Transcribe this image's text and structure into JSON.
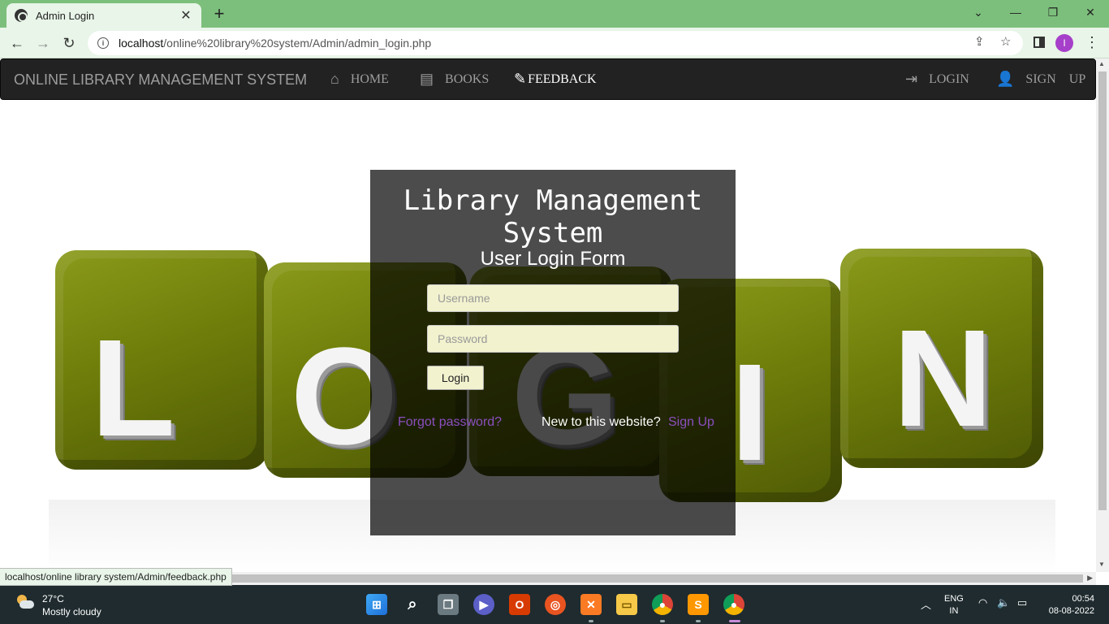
{
  "browser": {
    "tab_title": "Admin Login",
    "tab_close": "✕",
    "new_tab": "+",
    "url_host": "localhost",
    "url_path": "/online%20library%20system/Admin/admin_login.php",
    "profile_initial": "I",
    "status_url": "localhost/online library system/Admin/feedback.php"
  },
  "navbar": {
    "brand": "ONLINE LIBRARY MANAGEMENT SYSTEM",
    "home": "HOME",
    "books": "BOOKS",
    "feedback": "FEEDBACK",
    "login": "LOGIN",
    "signup": "SIGN    UP"
  },
  "hero": {
    "letters": [
      "L",
      "O",
      "G",
      "I",
      "N"
    ],
    "cube_color": "#6f7e0a"
  },
  "login_form": {
    "title": "Library Management System",
    "subtitle": "User Login Form",
    "username_placeholder": "Username",
    "password_placeholder": "Password",
    "login_button": "Login",
    "forgot_password": "Forgot password?",
    "new_user_prompt": "New to this website?",
    "sign_up": "Sign Up",
    "link_color": "#8a4fbf"
  },
  "taskbar": {
    "temperature": "27°C",
    "condition": "Mostly cloudy",
    "language_top": "ENG",
    "language_bottom": "IN",
    "time": "00:54",
    "date": "08-08-2022"
  }
}
